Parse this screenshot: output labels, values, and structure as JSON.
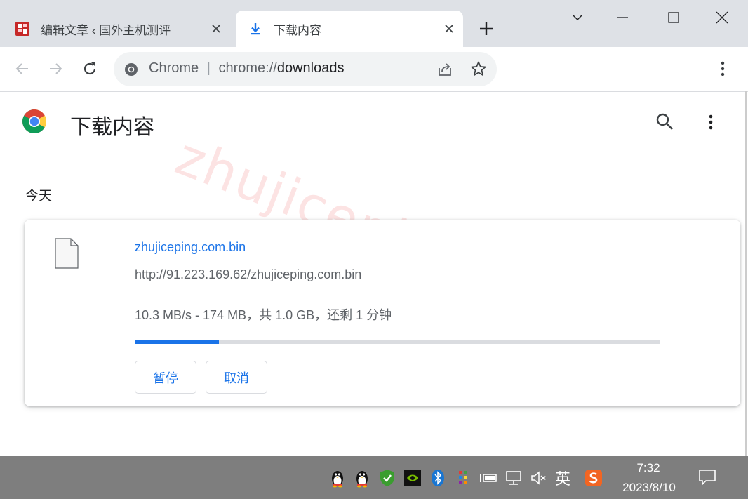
{
  "browser": {
    "tabs": [
      {
        "title": "编辑文章 ‹ 国外主机测评",
        "favicon": "site-seal-icon",
        "active": false
      },
      {
        "title": "下载内容",
        "favicon": "download-icon",
        "active": true
      }
    ],
    "omnibox": {
      "site_label": "Chrome",
      "separator": "|",
      "scheme": "chrome://",
      "path": "downloads"
    }
  },
  "page": {
    "title": "下载内容",
    "section": "今天",
    "watermark": "zhujiceping.com"
  },
  "download": {
    "file_name": "zhujiceping.com.bin",
    "url": "http://91.223.169.62/zhujiceping.com.bin",
    "status": "10.3 MB/s - 174 MB，共 1.0 GB，还剩 1 分钟",
    "progress_fraction": 0.16,
    "pause_label": "暂停",
    "cancel_label": "取消"
  },
  "taskbar": {
    "tray_input_method": "英",
    "time": "7:32",
    "date": "2023/8/10"
  },
  "colors": {
    "accent": "#1a73e8",
    "tab_strip": "#dee1e6",
    "taskbar": "#7e7e7e"
  }
}
